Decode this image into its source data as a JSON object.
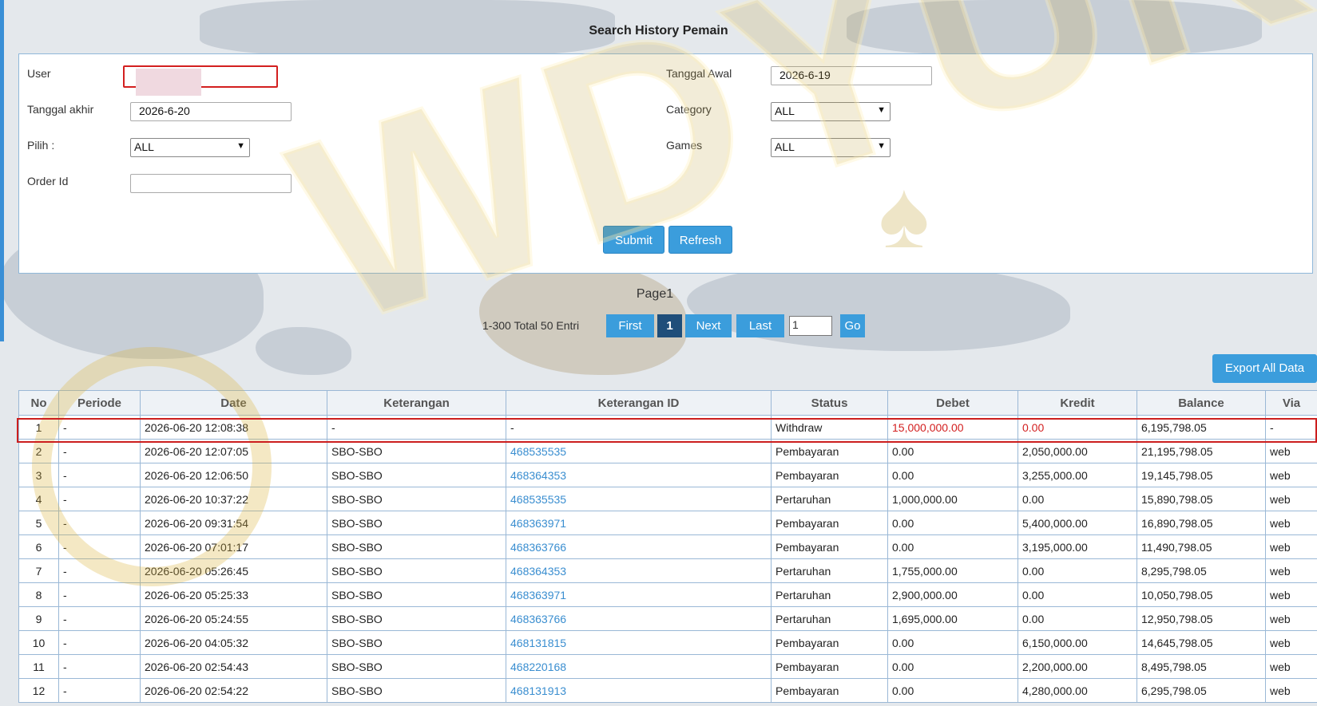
{
  "title": "Search History Pemain",
  "form": {
    "user_label": "User",
    "user_value": "",
    "tanggal_awal_label": "Tanggal Awal",
    "tanggal_awal_value": "2026-6-19",
    "tanggal_akhir_label": "Tanggal akhir",
    "tanggal_akhir_value": "2026-6-20",
    "category_label": "Category",
    "category_value": "ALL",
    "pilih_label": "Pilih  :",
    "pilih_value": "ALL",
    "games_label": "Games",
    "games_value": "ALL",
    "order_id_label": "Order Id",
    "order_id_value": "",
    "submit_label": "Submit",
    "refresh_label": "Refresh"
  },
  "pager": {
    "page_title": "Page1",
    "entries_text": "1-300 Total 50 Entri",
    "first_label": "First",
    "current_page": "1",
    "next_label": "Next",
    "last_label": "Last",
    "page_input_value": "1",
    "go_label": "Go"
  },
  "export_label": "Export All Data",
  "table": {
    "headers": [
      "No",
      "Periode",
      "Date",
      "Keterangan",
      "Keterangan ID",
      "Status",
      "Debet",
      "Kredit",
      "Balance",
      "Via"
    ],
    "rows": [
      [
        "1",
        "-",
        "2026-06-20 12:08:38",
        "-",
        "-",
        "Withdraw",
        "15,000,000.00",
        "0.00",
        "6,195,798.05",
        "-"
      ],
      [
        "2",
        "-",
        "2026-06-20 12:07:05",
        "SBO-SBO",
        "468535535",
        "Pembayaran",
        "0.00",
        "2,050,000.00",
        "21,195,798.05",
        "web"
      ],
      [
        "3",
        "-",
        "2026-06-20 12:06:50",
        "SBO-SBO",
        "468364353",
        "Pembayaran",
        "0.00",
        "3,255,000.00",
        "19,145,798.05",
        "web"
      ],
      [
        "4",
        "-",
        "2026-06-20 10:37:22",
        "SBO-SBO",
        "468535535",
        "Pertaruhan",
        "1,000,000.00",
        "0.00",
        "15,890,798.05",
        "web"
      ],
      [
        "5",
        "-",
        "2026-06-20 09:31:54",
        "SBO-SBO",
        "468363971",
        "Pembayaran",
        "0.00",
        "5,400,000.00",
        "16,890,798.05",
        "web"
      ],
      [
        "6",
        "-",
        "2026-06-20 07:01:17",
        "SBO-SBO",
        "468363766",
        "Pembayaran",
        "0.00",
        "3,195,000.00",
        "11,490,798.05",
        "web"
      ],
      [
        "7",
        "-",
        "2026-06-20 05:26:45",
        "SBO-SBO",
        "468364353",
        "Pertaruhan",
        "1,755,000.00",
        "0.00",
        "8,295,798.05",
        "web"
      ],
      [
        "8",
        "-",
        "2026-06-20 05:25:33",
        "SBO-SBO",
        "468363971",
        "Pertaruhan",
        "2,900,000.00",
        "0.00",
        "10,050,798.05",
        "web"
      ],
      [
        "9",
        "-",
        "2026-06-20 05:24:55",
        "SBO-SBO",
        "468363766",
        "Pertaruhan",
        "1,695,000.00",
        "0.00",
        "12,950,798.05",
        "web"
      ],
      [
        "10",
        "-",
        "2026-06-20 04:05:32",
        "SBO-SBO",
        "468131815",
        "Pembayaran",
        "0.00",
        "6,150,000.00",
        "14,645,798.05",
        "web"
      ],
      [
        "11",
        "-",
        "2026-06-20 02:54:43",
        "SBO-SBO",
        "468220168",
        "Pembayaran",
        "0.00",
        "2,200,000.00",
        "8,495,798.05",
        "web"
      ],
      [
        "12",
        "-",
        "2026-06-20 02:54:22",
        "SBO-SBO",
        "468131913",
        "Pembayaran",
        "0.00",
        "4,280,000.00",
        "6,295,798.05",
        "web"
      ]
    ]
  },
  "watermark": "WDYUK",
  "colors": {
    "accent": "#3b9ddc",
    "highlight_red": "#cc1e1e",
    "link": "#3a8ed0"
  }
}
